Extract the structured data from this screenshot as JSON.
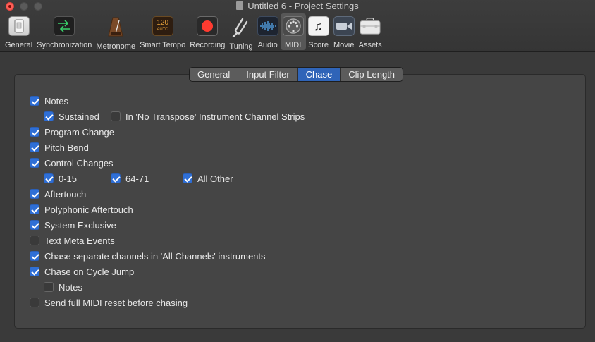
{
  "window": {
    "title": "Untitled 6 - Project Settings"
  },
  "toolbar": {
    "items": [
      {
        "label": "General",
        "icon": "general-icon"
      },
      {
        "label": "Synchronization",
        "icon": "sync-icon"
      },
      {
        "label": "Metronome",
        "icon": "metronome-icon"
      },
      {
        "label": "Smart Tempo",
        "icon": "smart-tempo-icon",
        "icon_text": "120",
        "icon_subtext": "AUTO"
      },
      {
        "label": "Recording",
        "icon": "record-icon"
      },
      {
        "label": "Tuning",
        "icon": "tuning-fork-icon"
      },
      {
        "label": "Audio",
        "icon": "waveform-icon"
      },
      {
        "label": "MIDI",
        "icon": "midi-icon",
        "selected": true
      },
      {
        "label": "Score",
        "icon": "score-icon",
        "icon_text": "♫"
      },
      {
        "label": "Movie",
        "icon": "movie-icon"
      },
      {
        "label": "Assets",
        "icon": "assets-icon"
      }
    ]
  },
  "tabs": [
    {
      "label": "General"
    },
    {
      "label": "Input Filter"
    },
    {
      "label": "Chase",
      "selected": true
    },
    {
      "label": "Clip Length"
    }
  ],
  "options": {
    "notes": {
      "label": "Notes",
      "checked": true
    },
    "sustained": {
      "label": "Sustained",
      "checked": true
    },
    "no_transpose": {
      "label": "In 'No Transpose' Instrument Channel Strips",
      "checked": false
    },
    "program_change": {
      "label": "Program Change",
      "checked": true
    },
    "pitch_bend": {
      "label": "Pitch Bend",
      "checked": true
    },
    "control_changes": {
      "label": "Control Changes",
      "checked": true
    },
    "cc_0_15": {
      "label": "0-15",
      "checked": true
    },
    "cc_64_71": {
      "label": "64-71",
      "checked": true
    },
    "cc_all_other": {
      "label": "All Other",
      "checked": true
    },
    "aftertouch": {
      "label": "Aftertouch",
      "checked": true
    },
    "poly_aftertouch": {
      "label": "Polyphonic Aftertouch",
      "checked": true
    },
    "sysex": {
      "label": "System Exclusive",
      "checked": true
    },
    "text_meta": {
      "label": "Text Meta Events",
      "checked": false
    },
    "separate_channels": {
      "label": "Chase separate channels in 'All Channels' instruments",
      "checked": true
    },
    "cycle_jump": {
      "label": "Chase on Cycle Jump",
      "checked": true
    },
    "cycle_notes": {
      "label": "Notes",
      "checked": false
    },
    "midi_reset": {
      "label": "Send full MIDI reset before chasing",
      "checked": false
    }
  },
  "colors": {
    "accent": "#2f6fd6",
    "selected_tab": "#2f64b8",
    "record": "#ff3b30"
  }
}
